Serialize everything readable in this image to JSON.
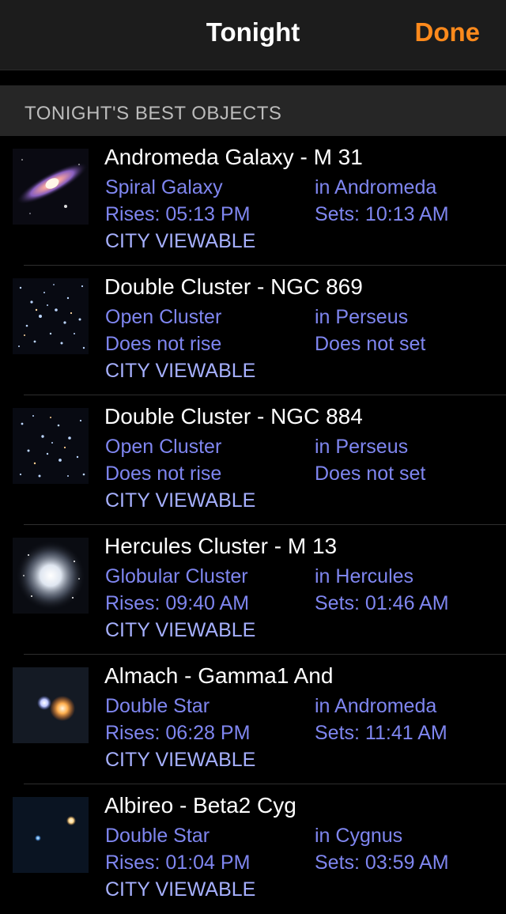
{
  "nav": {
    "title": "Tonight",
    "done_label": "Done",
    "done_color": "#ff8a1c"
  },
  "section": {
    "title": "TONIGHT'S BEST OBJECTS"
  },
  "objects": [
    {
      "name": "Andromeda Galaxy - M 31",
      "type": "Spiral Galaxy",
      "constellation": "in Andromeda",
      "rise": "Rises: 05:13 PM",
      "set": "Sets: 10:13 AM",
      "tag": "CITY VIEWABLE",
      "icon": "galaxy-thumbnail"
    },
    {
      "name": "Double Cluster - NGC 869",
      "type": "Open Cluster",
      "constellation": "in Perseus",
      "rise": "Does not rise",
      "set": "Does not set",
      "tag": "CITY VIEWABLE",
      "icon": "open-cluster-thumbnail"
    },
    {
      "name": "Double Cluster - NGC 884",
      "type": "Open Cluster",
      "constellation": "in Perseus",
      "rise": "Does not rise",
      "set": "Does not set",
      "tag": "CITY VIEWABLE",
      "icon": "open-cluster-thumbnail"
    },
    {
      "name": "Hercules Cluster - M 13",
      "type": "Globular Cluster",
      "constellation": "in Hercules",
      "rise": "Rises: 09:40 AM",
      "set": "Sets: 01:46 AM",
      "tag": "CITY VIEWABLE",
      "icon": "globular-cluster-thumbnail"
    },
    {
      "name": "Almach - Gamma1 And",
      "type": "Double Star",
      "constellation": "in Andromeda",
      "rise": "Rises: 06:28 PM",
      "set": "Sets: 11:41 AM",
      "tag": "CITY VIEWABLE",
      "icon": "double-star-thumbnail"
    },
    {
      "name": "Albireo - Beta2 Cyg",
      "type": "Double Star",
      "constellation": "in Cygnus",
      "rise": "Rises: 01:04 PM",
      "set": "Sets: 03:59 AM",
      "tag": "CITY VIEWABLE",
      "icon": "double-star-thumbnail"
    }
  ]
}
